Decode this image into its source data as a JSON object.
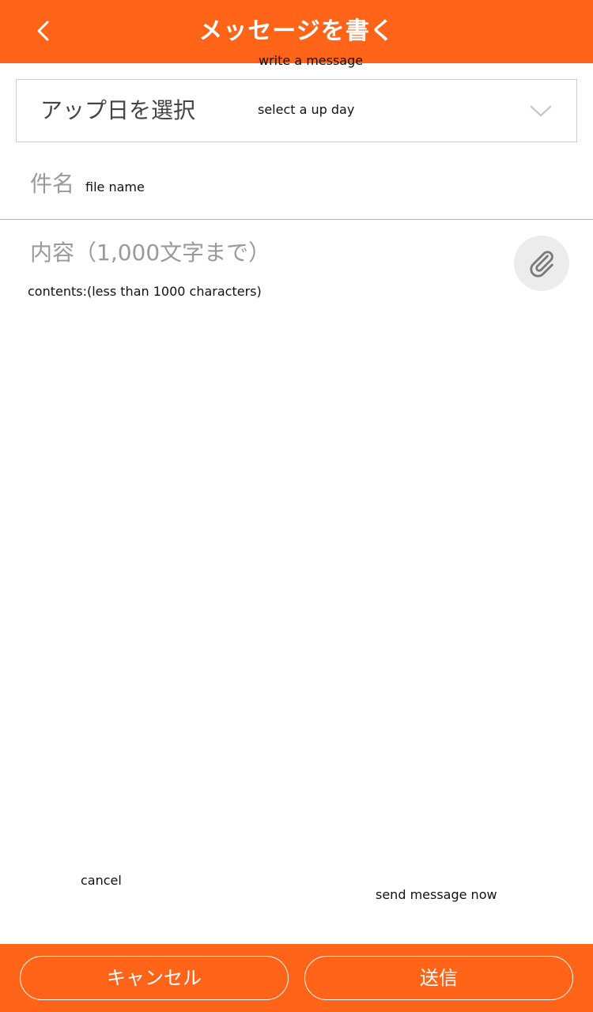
{
  "header": {
    "title": "メッセージを書く",
    "title_annotation": "write a message",
    "back_icon": "chevron-left-icon"
  },
  "date_select": {
    "label": "アップ日を選択",
    "annotation": "select a up day",
    "icon": "chevron-down-icon"
  },
  "subject": {
    "placeholder": "件名",
    "annotation": "file name"
  },
  "content": {
    "placeholder": "内容（1,000文字まで）",
    "annotation": "contents:(less than 1000 characters)",
    "attach_icon": "paperclip-icon"
  },
  "footer": {
    "cancel_label": "キャンセル",
    "cancel_annotation": "cancel",
    "send_label": "送信",
    "send_annotation": "send message now"
  },
  "colors": {
    "accent": "#ff6418",
    "placeholder": "#9a9a9a",
    "border": "#cfcfcf"
  }
}
